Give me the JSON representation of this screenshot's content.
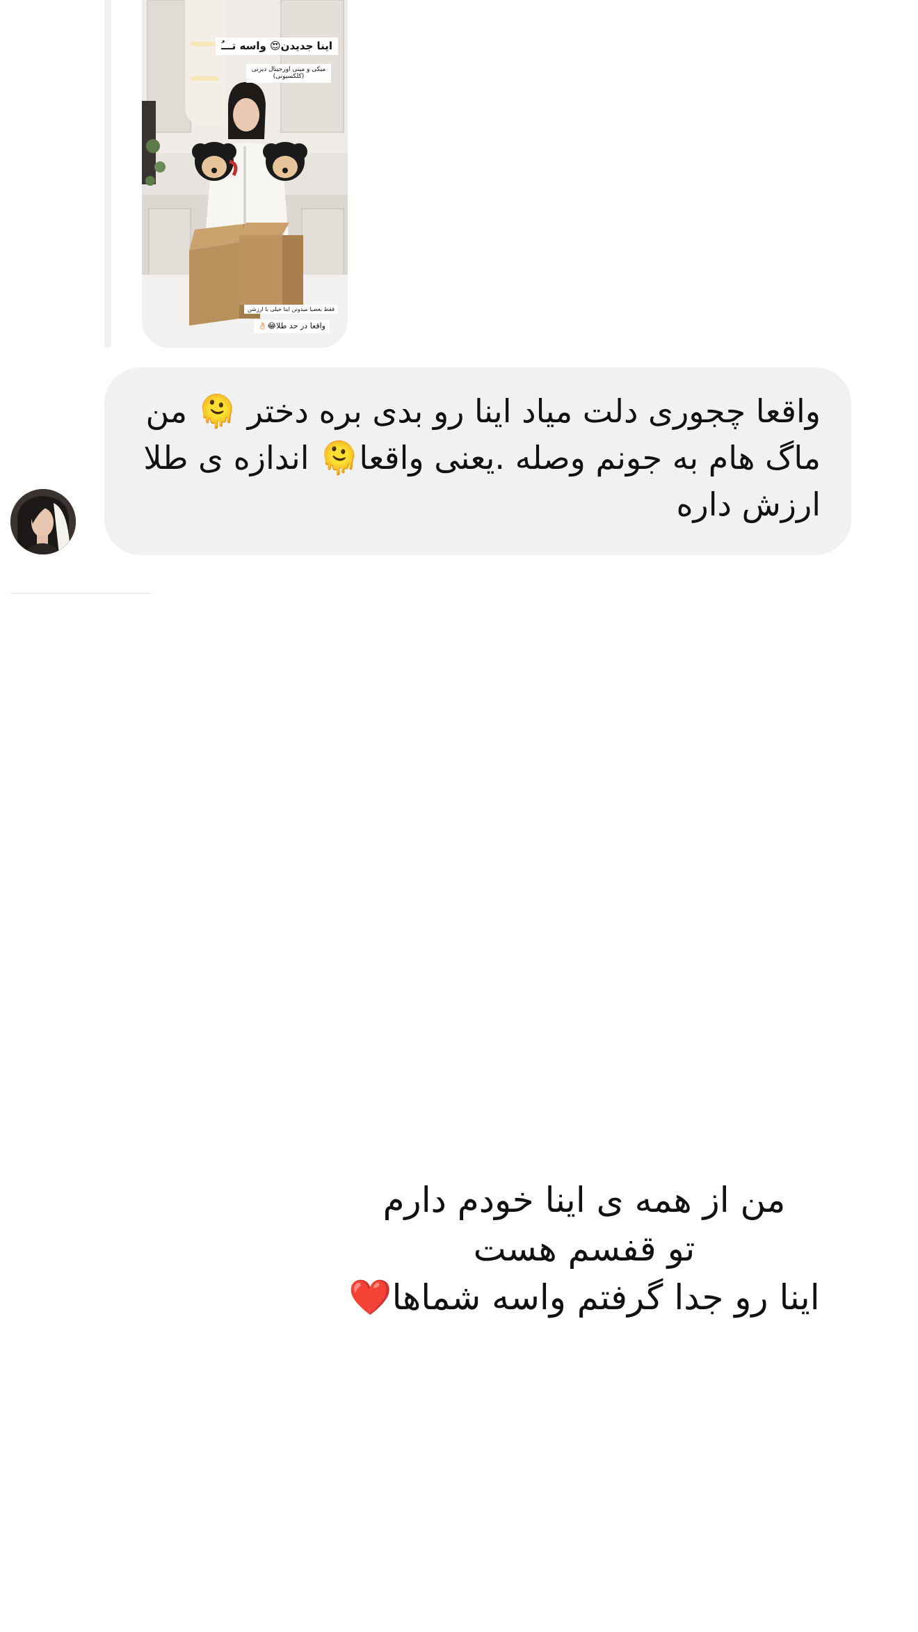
{
  "shared_post": {
    "caption_top": "اینا جدیدن😍 واسه تـــُ",
    "caption_sub": "میکی و مینی اورجینال دیزنی (کلکسیونی)",
    "caption_sub2": "فقط بعضیا میدونن اینا خیلی با ارزشن",
    "caption_bottom": "واقعا در حد طلا😂👌🏻"
  },
  "message": {
    "text": "واقعا چجوری دلت میاد اینا رو بدی بره دختر 🫠 من ماگ هام به جونم وصله .یعنی واقعا🫠 اندازه ی طلا ارزش داره",
    "emoji_1": "🫠",
    "emoji_2": "🫠"
  },
  "avatar_icon": "profile-photo-icon",
  "story": {
    "lines": [
      "من از همه ی اینا خودم دارم",
      "تو قفسم هست",
      "اینا رو جدا گرفتم واسه شماها❤️"
    ]
  },
  "colors": {
    "bubble_bg": "#f0f1f3",
    "text": "#111111",
    "reply_line": "#eef0f2"
  }
}
